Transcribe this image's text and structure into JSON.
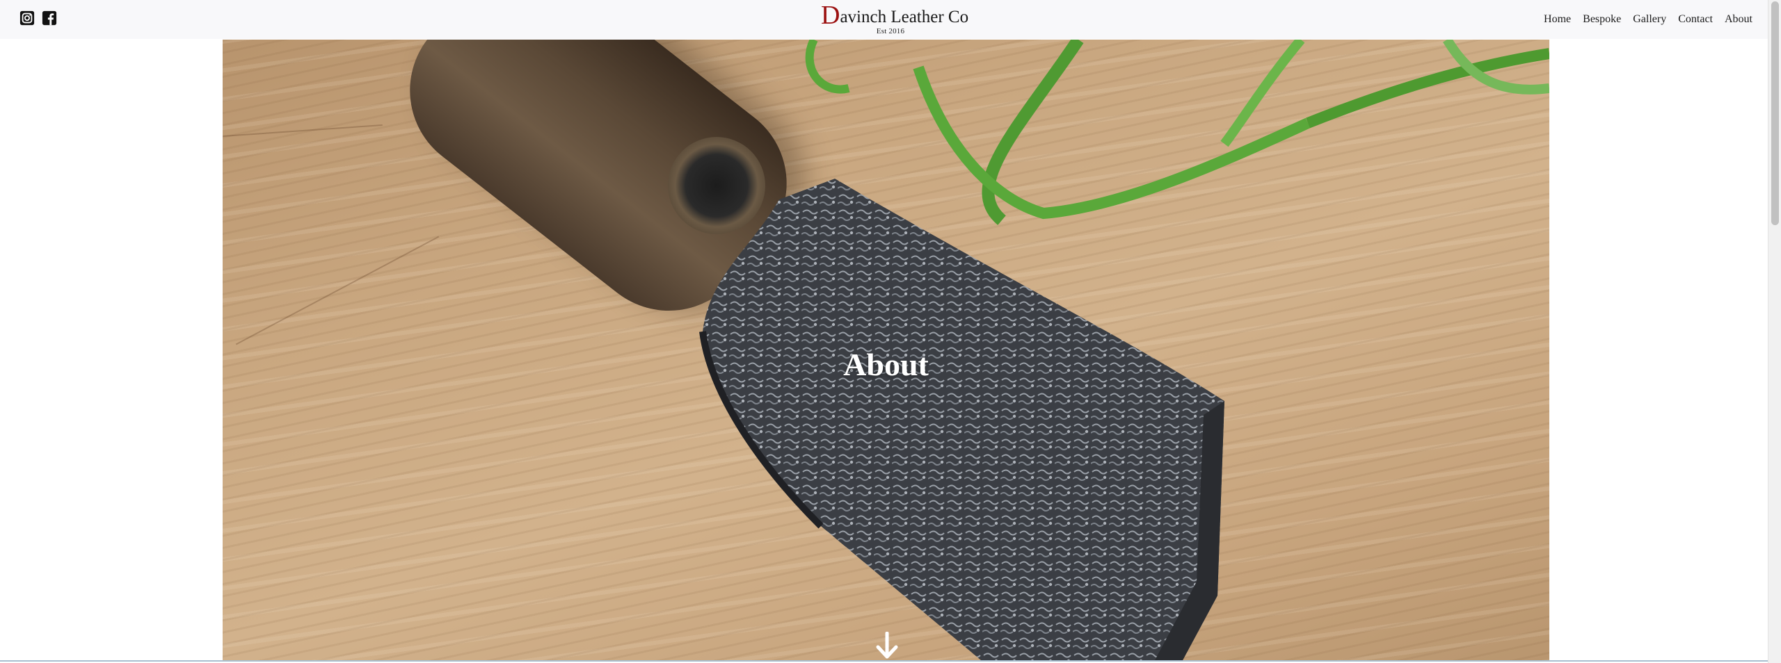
{
  "header": {
    "brand": {
      "initial": "D",
      "rest": "avinch Leather Co",
      "tagline": "Est 2016"
    },
    "social": [
      {
        "name": "instagram",
        "icon": "instagram-icon"
      },
      {
        "name": "facebook",
        "icon": "facebook-icon"
      }
    ],
    "nav": [
      "Home",
      "Bespoke",
      "Gallery",
      "Contact",
      "About"
    ]
  },
  "hero": {
    "title": "About",
    "scroll_icon": "arrow-down-icon"
  },
  "colors": {
    "brand_initial": "#9b1010",
    "header_bg": "#f8f8fa",
    "text": "#1a1a1a"
  }
}
